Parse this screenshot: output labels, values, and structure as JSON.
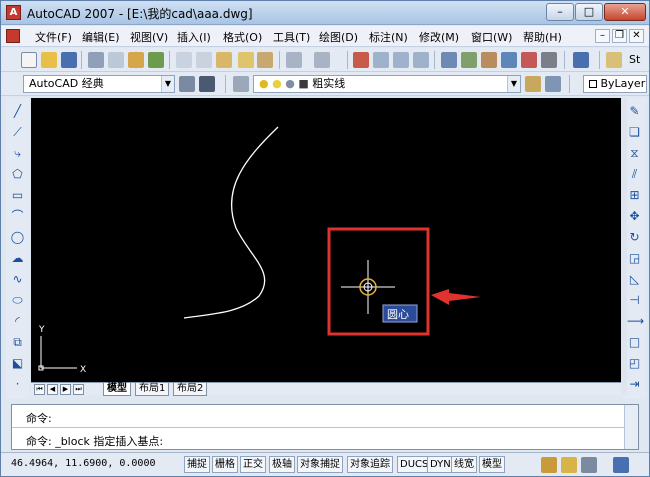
{
  "window": {
    "title": "AutoCAD 2007 - [E:\\我的cad\\aaa.dwg]",
    "minimize": "–",
    "maximize": "□",
    "close": "✕"
  },
  "menu": {
    "items": [
      "文件(F)",
      "编辑(E)",
      "视图(V)",
      "插入(I)",
      "格式(O)",
      "工具(T)",
      "绘图(D)",
      "标注(N)",
      "修改(M)",
      "窗口(W)",
      "帮助(H)"
    ],
    "doc_minimize": "–",
    "doc_restore": "❐",
    "doc_close": "✕"
  },
  "toolbar2": {
    "workspace": "AutoCAD 经典",
    "layer": "粗实线",
    "bylayer": "ByLayer",
    "style_stub": "St"
  },
  "canvas": {
    "tooltip": "圆心",
    "ucs_x": "X",
    "ucs_y": "Y",
    "highlight_color": "#e0332e",
    "curve_color": "#ffffff"
  },
  "tabs": {
    "items": [
      "模型",
      "布局1",
      "布局2"
    ]
  },
  "command": {
    "line1": "命令:",
    "line2": "命令: _block 指定插入基点:"
  },
  "status": {
    "coords": "46.4964, 11.6900, 0.0000",
    "buttons": [
      "捕捉",
      "栅格",
      "正交",
      "极轴",
      "对象捕捉",
      "对象追踪",
      "DUCS",
      "DYN",
      "线宽",
      "模型"
    ]
  }
}
